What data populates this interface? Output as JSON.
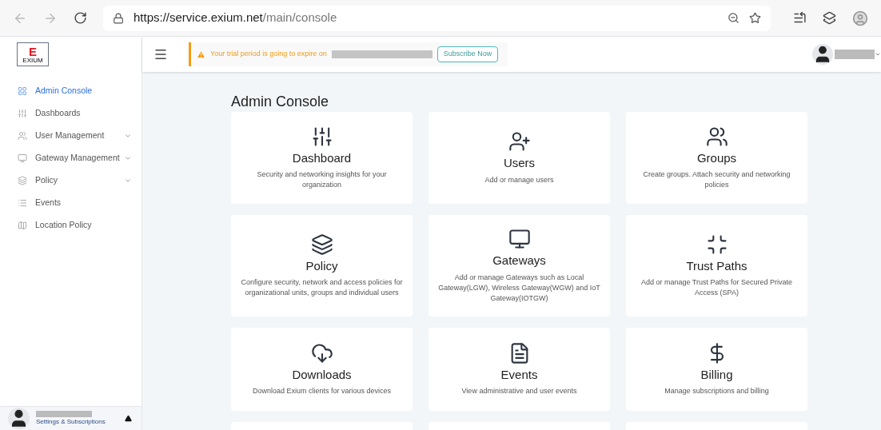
{
  "browser": {
    "url_host": "https://service.exium.net",
    "url_path": "/main/console"
  },
  "logo": {
    "letter": "E",
    "word": "EXIUM"
  },
  "sidebar": {
    "items": [
      {
        "label": "Admin Console",
        "selected": true,
        "has_submenu": false
      },
      {
        "label": "Dashboards",
        "selected": false,
        "has_submenu": false
      },
      {
        "label": "User Management",
        "selected": false,
        "has_submenu": true
      },
      {
        "label": "Gateway Management",
        "selected": false,
        "has_submenu": true
      },
      {
        "label": "Policy",
        "selected": false,
        "has_submenu": true
      },
      {
        "label": "Events",
        "selected": false,
        "has_submenu": false
      },
      {
        "label": "Location Policy",
        "selected": false,
        "has_submenu": false
      }
    ],
    "footer": {
      "link": "Settings & Subscriptions"
    }
  },
  "banner": {
    "message": "Your trial period is going to expire on",
    "button": "Subscribe Now"
  },
  "page_title": "Admin Console",
  "cards": [
    {
      "title": "Dashboard",
      "description": "Security and networking insights for your organization"
    },
    {
      "title": "Users",
      "description": "Add or manage users"
    },
    {
      "title": "Groups",
      "description": "Create groups. Attach security and networking policies"
    },
    {
      "title": "Policy",
      "description": "Configure security, network and access policies for organizational units, groups and individual users"
    },
    {
      "title": "Gateways",
      "description": "Add or manage Gateways such as Local Gateway(LGW), Wireless Gateway(WGW) and IoT Gateway(IOTGW)"
    },
    {
      "title": "Trust Paths",
      "description": "Add or manage Trust Paths for Secured Private Access (SPA)"
    },
    {
      "title": "Downloads",
      "description": "Download Exium clients for various devices"
    },
    {
      "title": "Events",
      "description": "View administrative and user events"
    },
    {
      "title": "Billing",
      "description": "Manage subscriptions and billing"
    }
  ]
}
